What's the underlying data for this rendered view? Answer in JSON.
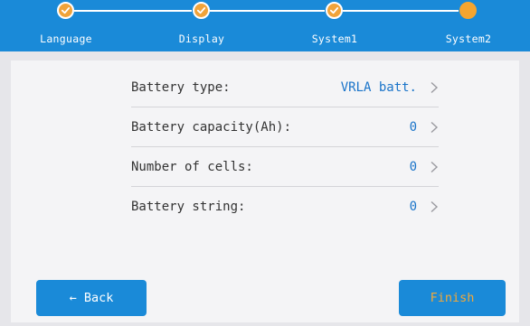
{
  "steps": [
    {
      "label": "Language",
      "state": "done"
    },
    {
      "label": "Display",
      "state": "done"
    },
    {
      "label": "System1",
      "state": "done"
    },
    {
      "label": "System2",
      "state": "current"
    }
  ],
  "settings": [
    {
      "label": "Battery type:",
      "value": "VRLA batt."
    },
    {
      "label": "Battery capacity(Ah):",
      "value": "0"
    },
    {
      "label": "Number of cells:",
      "value": "0"
    },
    {
      "label": "Battery string:",
      "value": "0"
    }
  ],
  "buttons": {
    "back_arrow": "←",
    "back_label": "Back",
    "finish_label": "Finish"
  },
  "icons": {
    "step_done": "check-icon",
    "row_nav": "chevron-right-icon",
    "back": "arrow-left-icon"
  },
  "colors": {
    "accent": "#1a8ad8",
    "value_text": "#1a74c9",
    "current_step": "#f5a530",
    "finish_text": "#f3a838"
  }
}
